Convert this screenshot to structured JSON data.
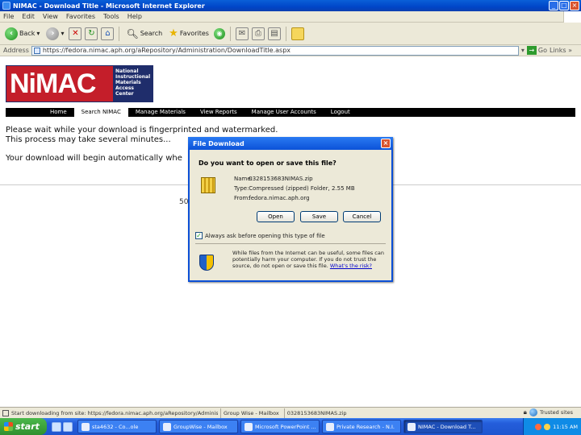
{
  "window": {
    "title": "NIMAC - Download Title - Microsoft Internet Explorer",
    "min": "_",
    "max": "□",
    "close": "×"
  },
  "menu": [
    "File",
    "Edit",
    "View",
    "Favorites",
    "Tools",
    "Help"
  ],
  "toolbar": {
    "back": "Back",
    "search": "Search",
    "favorites": "Favorites"
  },
  "address": {
    "label": "Address",
    "url": "https://fedora.nimac.aph.org/aRepository/Administration/DownloadTitle.aspx",
    "go": "Go",
    "links": "Links »"
  },
  "logo": {
    "mark": "NiMAC",
    "lines": [
      "National",
      "Instructional",
      "Materials",
      "Access",
      "Center"
    ]
  },
  "nav": [
    "Home",
    "Search NIMAC",
    "Manage Materials",
    "View Reports",
    "Manage User Accounts",
    "Logout"
  ],
  "page": {
    "line1": "Please wait while your download is fingerprinted and watermarked.",
    "line2": "This process may take several minutes...",
    "line3": "Your download will begin automatically whe",
    "partial": "50"
  },
  "dialog": {
    "title": "File Download",
    "question": "Do you want to open or save this file?",
    "name_label": "Name:",
    "name_value": "0328153683NIMAS.zip",
    "type_label": "Type:",
    "type_value": "Compressed (zipped) Folder, 2.55 MB",
    "from_label": "From:",
    "from_value": "fedora.nimac.aph.org",
    "open": "Open",
    "save": "Save",
    "cancel": "Cancel",
    "checkbox": "Always ask before opening this type of file",
    "warning": "While files from the Internet can be useful, some files can potentially harm your computer. If you do not trust the source, do not open or save this file.",
    "risk_link": "What's the risk?"
  },
  "status": {
    "text": "Start downloading from site: https://fedora.nimac.aph.org/aRepository/Administration/DownloadTitle.aspx",
    "cell1": "Group Wise - Mailbox",
    "cell2": "0328153683NIMAS.zip",
    "zone": "Trusted sites"
  },
  "taskbar": {
    "start": "start",
    "tasks": [
      "sta4632 - Co...ole",
      "GroupWise - Mailbox",
      "Microsoft PowerPoint ...",
      "Private Research - N.I.",
      "NIMAC - Download T..."
    ],
    "clock": "11:15 AM"
  }
}
